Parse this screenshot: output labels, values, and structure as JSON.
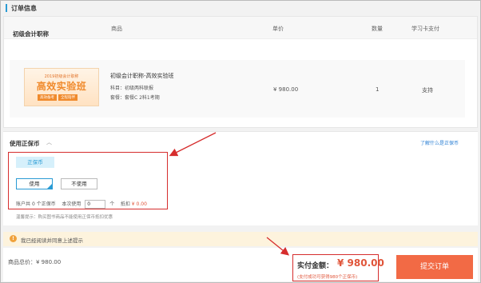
{
  "order": {
    "section_title": "订单信息",
    "columns": [
      "商品",
      "单价",
      "数量",
      "学习卡支付"
    ],
    "category": "初级会计职称",
    "item": {
      "thumb_small": "2019初级会计职称",
      "thumb_big": "高效实验班",
      "thumb_tags": [
        "高效备考",
        "全程陪伴"
      ],
      "title": "初级会计职称-高效实验班",
      "subject": "科目：初级两科联报",
      "package": "套餐：套餐C 2科1考期",
      "price": "¥ 980.00",
      "quantity": "1",
      "card_pay": "支持"
    }
  },
  "ensure": {
    "title": "使用正保币",
    "caret": "︿",
    "help_link": "了解什么是正保币",
    "tab": "正保币",
    "use_label": "使用",
    "not_use_label": "不使用",
    "account_prefix": "账户共",
    "account_amount": "0",
    "account_suffix": "个正保币",
    "this_use_label": "本次使用",
    "this_use_value": "0",
    "unit": "个",
    "deduct_label": "抵扣",
    "deduct_value": "¥ 0.00",
    "tip": "温馨提示：购买图书商品不能使用正保币抵扣优惠"
  },
  "agree": {
    "icon": "!",
    "text": "我已经阅读并同意上述提示"
  },
  "footer": {
    "total": "商品总价：¥ 980.00",
    "pay_label": "实付金额：",
    "pay_amount": "¥ 980.00",
    "pay_note": "(支付成功可获得980个正保币)",
    "submit_label": "提交订单"
  },
  "colors": {
    "accent": "#2a9bd4",
    "price_red": "#e0553a",
    "submit": "#f26a45",
    "annotation_red": "#d62d2d"
  }
}
